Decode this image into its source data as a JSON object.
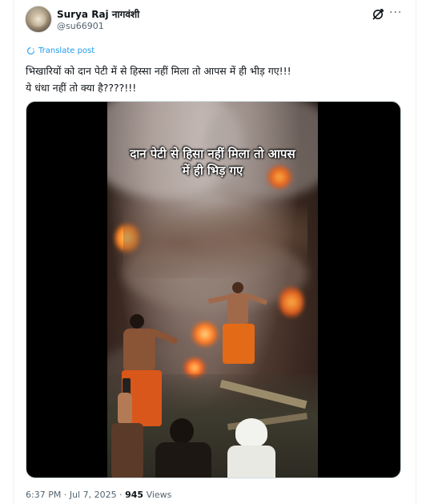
{
  "tweet": {
    "author_name": "Surya Raj नागवंशी",
    "author_handle": "@su66901",
    "translate_label": "Translate post",
    "text_line1": "भिखारियों को दान पेटी में से हिस्सा नहीं मिला तो आपस में ही भीड़ गए!!!",
    "text_line2": "ये धंधा नहीं तो क्या है????!!!",
    "video_caption_line1": "दान पेटी से हिसा नहीं मिला तो आपस",
    "video_caption_line2": "में ही भिड़ गए",
    "time": "6:37 PM",
    "separator": "·",
    "date": "Jul 7, 2025",
    "views_count": "945",
    "views_label": "Views"
  },
  "icons": {
    "grok": "grok-icon",
    "more": "more-icon",
    "translate": "translate-icon"
  },
  "colors": {
    "link": "#1d9bf0",
    "secondary_text": "#536471",
    "primary_text": "#0f1419",
    "border": "#cfd9de"
  }
}
